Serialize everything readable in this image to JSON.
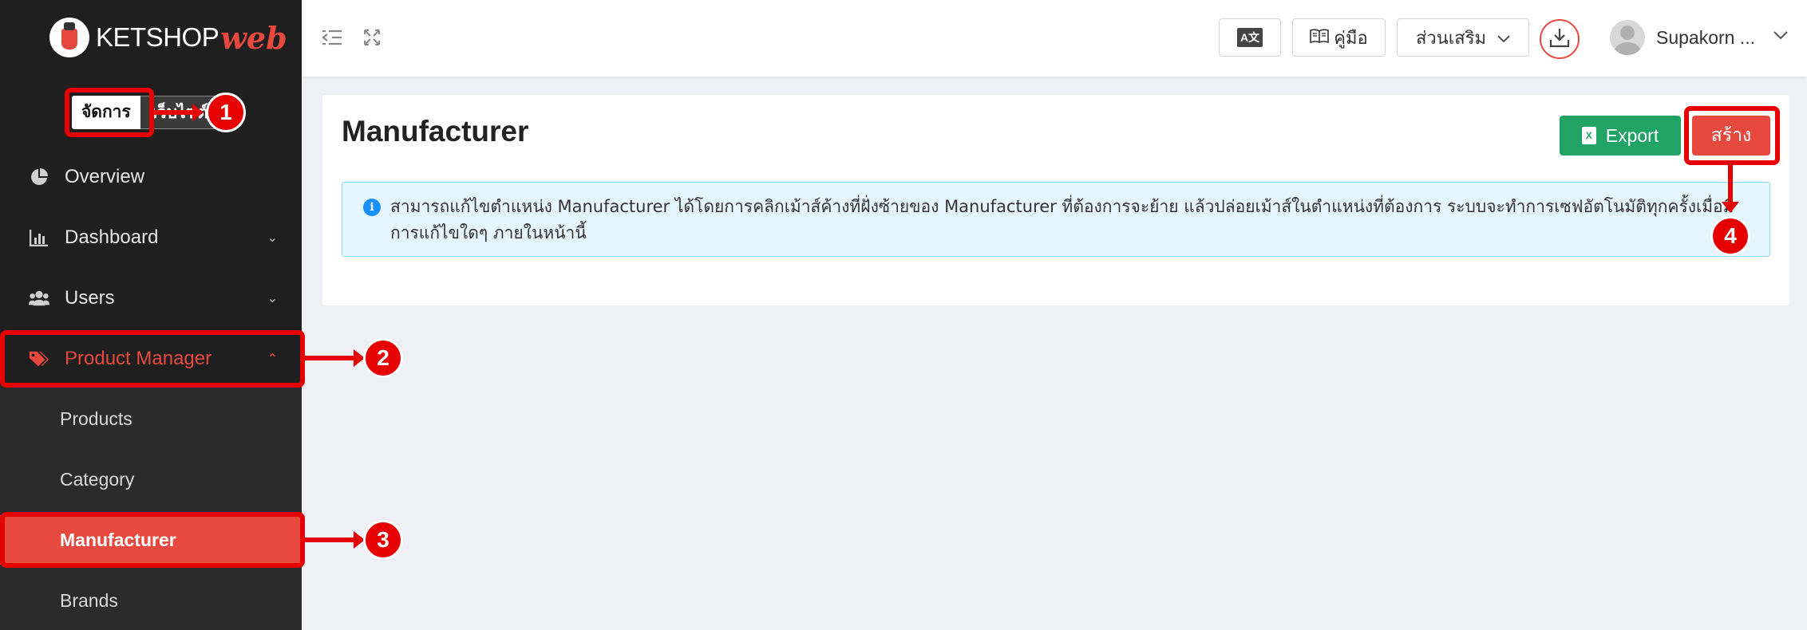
{
  "brand": {
    "name": "KETSHOP",
    "suffix": "web"
  },
  "mode_switch": {
    "manage": "จัดการ",
    "website": "เว็บไซต์"
  },
  "sidebar": {
    "items": [
      {
        "label": "Overview",
        "icon": "pie-chart-icon"
      },
      {
        "label": "Dashboard",
        "icon": "bar-chart-icon"
      },
      {
        "label": "Users",
        "icon": "users-icon"
      },
      {
        "label": "Product Manager",
        "icon": "tags-icon"
      }
    ],
    "sub_items": [
      {
        "label": "Products"
      },
      {
        "label": "Category"
      },
      {
        "label": "Manufacturer"
      },
      {
        "label": "Brands"
      }
    ]
  },
  "header": {
    "translate_label": "A文",
    "manual_label": "คู่มือ",
    "addons_label": "ส่วนเสริม",
    "user_name": "Supakorn ..."
  },
  "page": {
    "title": "Manufacturer",
    "export_label": "Export",
    "create_label": "สร้าง",
    "info_text": "สามารถแก้ไขตำแหน่ง Manufacturer ได้โดยการคลิกเม้าส์ค้างที่ฝั่งซ้ายของ Manufacturer ที่ต้องการจะย้าย แล้วปล่อยเม้าส์ในตำแหน่งที่ต้องการ ระบบจะทำการเซฟอัตโนมัติทุกครั้งเมื่อมีการแก้ไขใดๆ ภายในหน้านี้"
  },
  "annotations": [
    "1",
    "2",
    "3",
    "4"
  ],
  "colors": {
    "accent": "#e8493f",
    "export": "#21a366",
    "annotation": "#e60000",
    "sidebar": "#1f1f1f"
  }
}
